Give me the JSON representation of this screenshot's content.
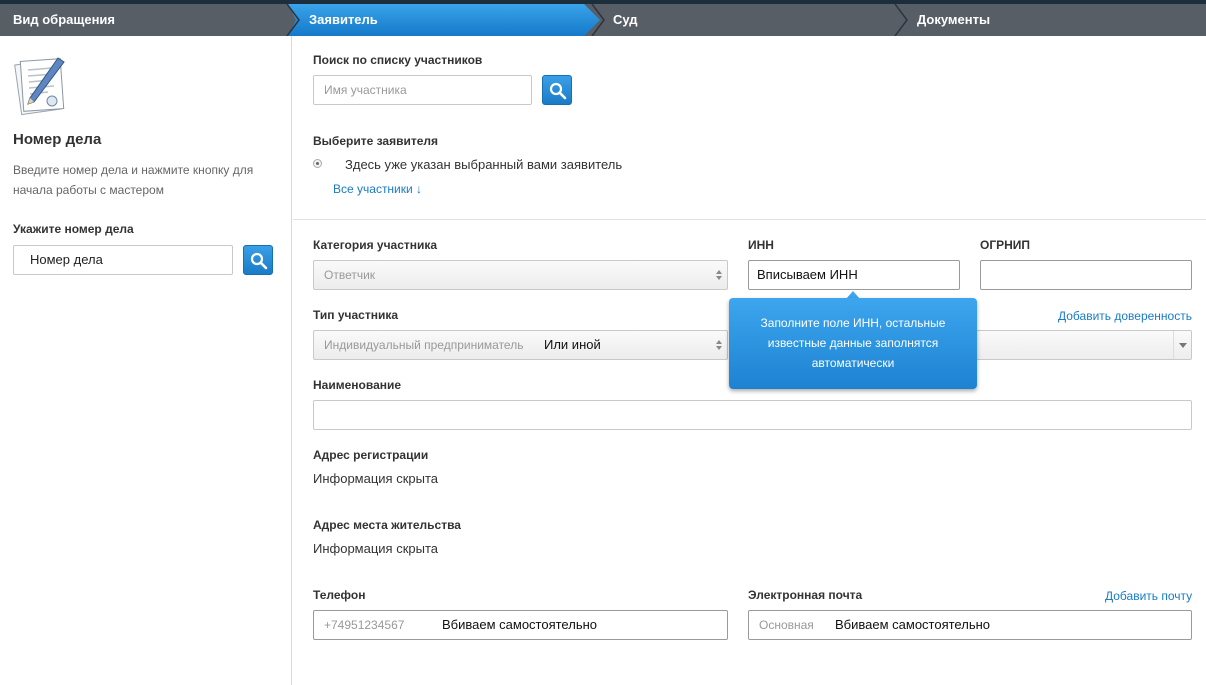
{
  "steps": [
    "Вид обращения",
    "Заявитель",
    "Суд",
    "Документы"
  ],
  "sidebar": {
    "title": "Номер дела",
    "description": "Введите номер дела и нажмите кнопку для начала работы с мастером",
    "label": "Укажите номер дела",
    "case_input_value": "Номер дела"
  },
  "search": {
    "label": "Поиск по списку участников",
    "placeholder": "Имя участника"
  },
  "applicant": {
    "label": "Выберите заявителя",
    "option": "Здесь уже указан выбранный вами заявитель",
    "all_link": "Все участники ↓"
  },
  "form": {
    "category_label": "Категория участника",
    "category_value": "Ответчик",
    "inn_label": "ИНН",
    "inn_value": "Вписываем ИНН",
    "ogrnip_label": "ОГРНИП",
    "type_label": "Тип участника",
    "type_value": "Индивидуальный предприниматель",
    "type_note": "Или иной",
    "add_proxy_link": "Добавить доверенность",
    "name_label": "Наименование",
    "reg_address_label": "Адрес регистрации",
    "reg_address_value": "Информация скрыта",
    "live_address_label": "Адрес места жительства",
    "live_address_value": "Информация скрыта",
    "phone_label": "Телефон",
    "phone_placeholder": "+74951234567",
    "phone_note": "Вбиваем самостоятельно",
    "email_label": "Электронная почта",
    "add_email_link": "Добавить почту",
    "email_placeholder": "Основная",
    "email_note": "Вбиваем самостоятельно"
  },
  "tooltip": {
    "text": "Заполните поле ИНН, остальные известные данные заполнятся автоматически"
  },
  "colors": {
    "accent": "#1a7bc6",
    "topbar": "#585e66",
    "tooltip": "#2b93e0"
  }
}
